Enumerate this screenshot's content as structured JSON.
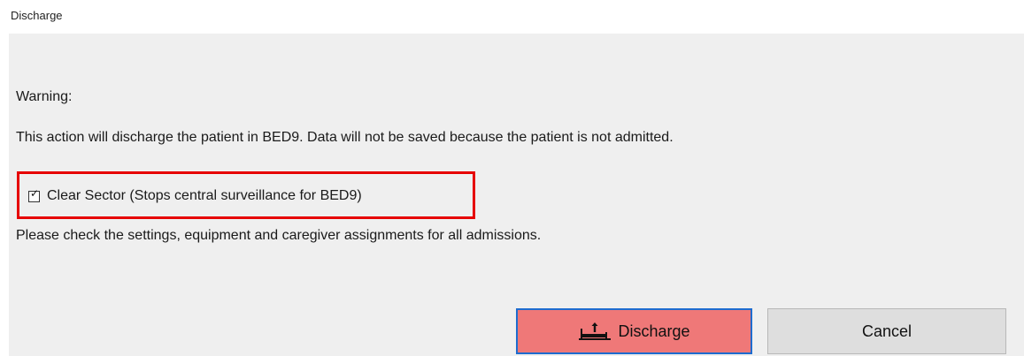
{
  "window": {
    "title": "Discharge"
  },
  "dialog": {
    "warning_label": "Warning:",
    "message": "This action will discharge the patient in BED9.  Data will not be saved because the patient is not admitted.",
    "clear_sector": {
      "label": "Clear Sector (Stops central surveillance for BED9)",
      "checked": true
    },
    "note": "Please check the settings, equipment and caregiver assignments for all admissions."
  },
  "buttons": {
    "discharge_label": "Discharge",
    "cancel_label": "Cancel"
  },
  "icons": {
    "discharge_icon": "bed-discharge-icon",
    "checkbox_icon": "checkbox-checked-icon"
  },
  "colors": {
    "dialog_background": "#efefef",
    "discharge_button_fill": "#ef7878",
    "discharge_button_border": "#1e6ccf",
    "highlight_frame": "#e60000"
  }
}
